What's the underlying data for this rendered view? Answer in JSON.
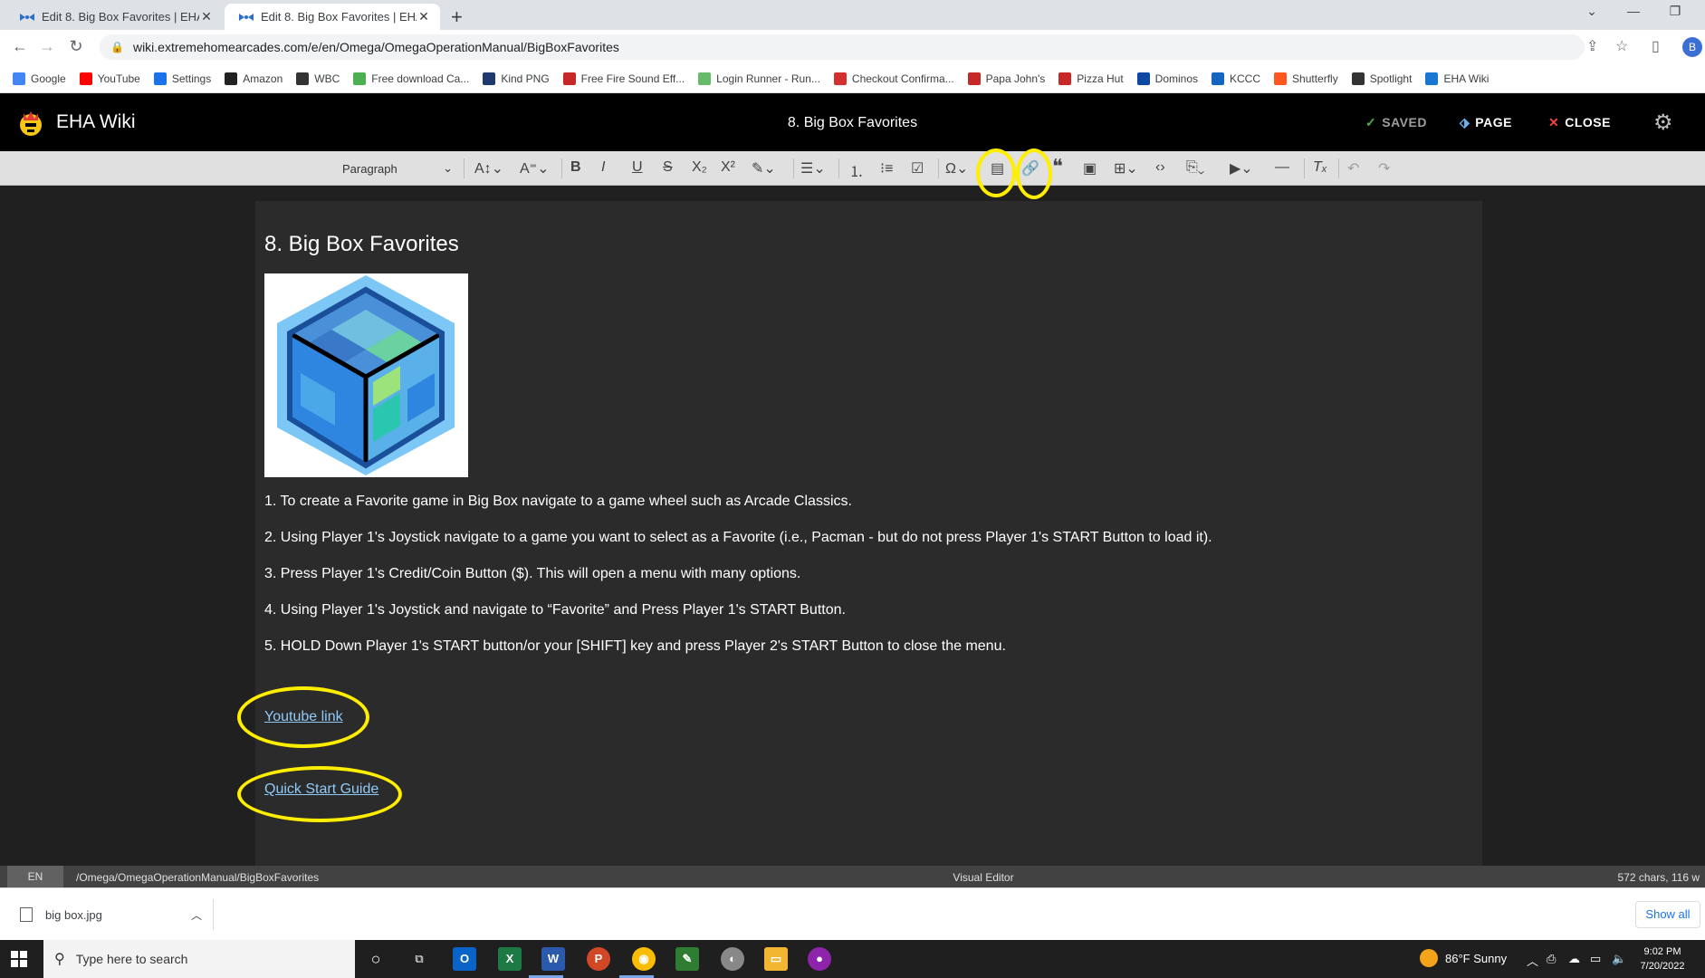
{
  "browser": {
    "tabs": [
      {
        "title": "Edit 8. Big Box Favorites | EHA Wiki"
      },
      {
        "title": "Edit 8. Big Box Favorites | EHA Wiki"
      }
    ],
    "new_tab": "+",
    "url": "wiki.extremehomearcades.com/e/en/Omega/OmegaOperationManual/BigBoxFavorites",
    "profile_initial": "B",
    "bookmarks": [
      {
        "label": "Google",
        "color": "#4285f4"
      },
      {
        "label": "YouTube",
        "color": "#ff0000"
      },
      {
        "label": "Settings",
        "color": "#1a73e8"
      },
      {
        "label": "Amazon",
        "color": "#222222"
      },
      {
        "label": "WBC",
        "color": "#333333"
      },
      {
        "label": "Free download Ca...",
        "color": "#4caf50"
      },
      {
        "label": "Kind PNG",
        "color": "#1e3a6e"
      },
      {
        "label": "Free Fire Sound Eff...",
        "color": "#c62828"
      },
      {
        "label": "Login Runner - Run...",
        "color": "#66bb6a"
      },
      {
        "label": "Checkout Confirma...",
        "color": "#d32f2f"
      },
      {
        "label": "Papa John's",
        "color": "#c62828"
      },
      {
        "label": "Pizza Hut",
        "color": "#c62828"
      },
      {
        "label": "Dominos",
        "color": "#0d47a1"
      },
      {
        "label": "KCCC",
        "color": "#1565c0"
      },
      {
        "label": "Shutterfly",
        "color": "#ff5722"
      },
      {
        "label": "Spotlight",
        "color": "#333333"
      },
      {
        "label": "EHA Wiki",
        "color": "#1976d2"
      }
    ]
  },
  "app": {
    "title": "EHA Wiki",
    "page_title": "8. Big Box Favorites",
    "saved_label": "SAVED",
    "page_label": "PAGE",
    "close_label": "CLOSE"
  },
  "toolbar": {
    "paragraph_label": "Paragraph"
  },
  "document": {
    "heading": "8. Big Box Favorites",
    "steps": [
      "1. To create a Favorite game in Big Box navigate to a game wheel such as Arcade Classics.",
      "2. Using Player 1's Joystick navigate to a game you want to select as a Favorite (i.e., Pacman - but do not press Player 1's START Button to load it).",
      "3. Press Player 1's Credit/Coin Button ($).  This will open a menu with many options.",
      "4. Using Player 1's Joystick and navigate to “Favorite” and Press Player 1's START Button.",
      "5. HOLD Down Player 1's START button/or your [SHIFT] key and press Player 2's START Button to close the menu."
    ],
    "links": {
      "youtube": "Youtube link",
      "quick_start": "Quick Start Guide"
    }
  },
  "statusbar": {
    "lang": "EN",
    "path": "/Omega/OmegaOperationManual/BigBoxFavorites",
    "mode": "Visual Editor",
    "chars": "572 chars, 116 w"
  },
  "downloads": {
    "file": "big box.jpg",
    "show_all": "Show all"
  },
  "taskbar": {
    "search_placeholder": "Type here to search",
    "weather": "86°F  Sunny",
    "time": "9:02 PM",
    "date": "7/20/2022"
  },
  "colors": {
    "app_bar": "#000000",
    "editor_bg": "#2b2b2b",
    "link": "#90caf9",
    "highlight_ring": "#ffee00"
  }
}
